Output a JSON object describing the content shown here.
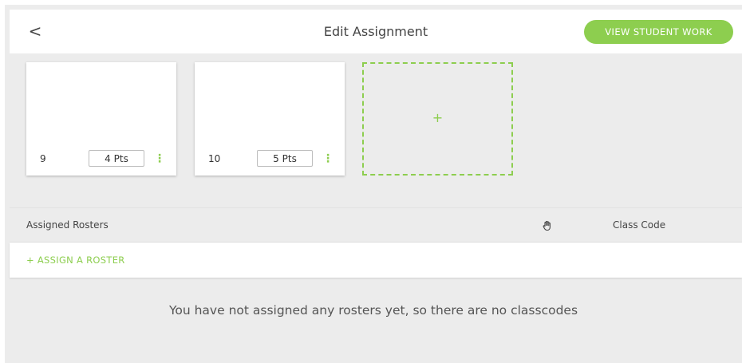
{
  "header": {
    "back_glyph": "<",
    "title": "Edit Assignment",
    "view_work_label": "VIEW STUDENT WORK"
  },
  "cards": [
    {
      "number": "9",
      "points": "4 Pts",
      "menu_glyph": "⋮"
    },
    {
      "number": "10",
      "points": "5 Pts",
      "menu_glyph": "⋮"
    }
  ],
  "add_card": {
    "glyph": "+"
  },
  "rosters": {
    "title": "Assigned Rosters",
    "hand_icon": "hand-icon",
    "class_code_label": "Class Code",
    "assign_label": "+ ASSIGN A ROSTER",
    "empty_message": "You have not assigned any rosters yet, so there are no classcodes"
  },
  "colors": {
    "accent": "#8dce4f",
    "background": "#ececec"
  }
}
